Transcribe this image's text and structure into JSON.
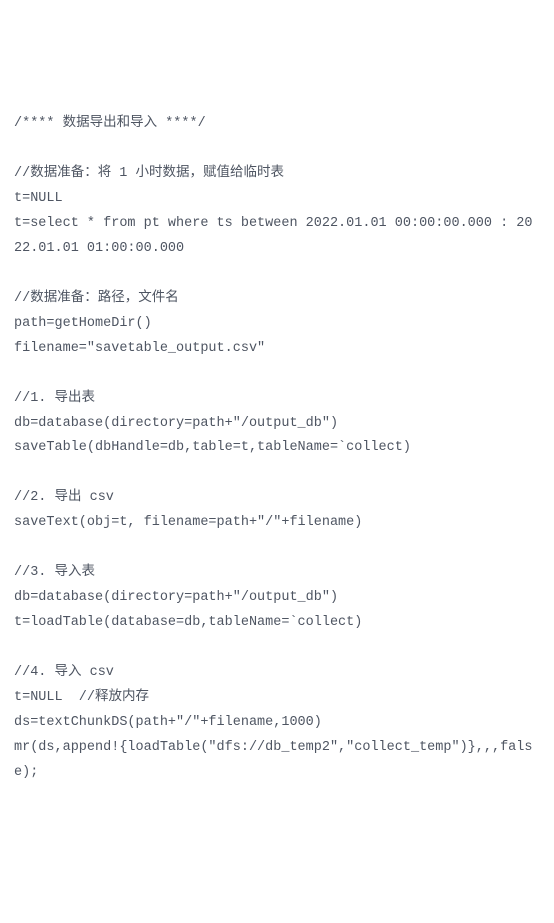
{
  "code": {
    "lines": [
      "/**** 数据导出和导入 ****/",
      "",
      "//数据准备：将 1 小时数据，赋值给临时表",
      "t=NULL",
      "t=select * from pt where ts between 2022.01.01 00:00:00.000 : 2022.01.01 01:00:00.000",
      "",
      "//数据准备：路径，文件名",
      "path=getHomeDir()",
      "filename=\"savetable_output.csv\"",
      "",
      "//1. 导出表",
      "db=database(directory=path+\"/output_db\")",
      "saveTable(dbHandle=db,table=t,tableName=`collect)",
      "",
      "//2. 导出 csv",
      "saveText(obj=t, filename=path+\"/\"+filename)",
      "",
      "//3. 导入表",
      "db=database(directory=path+\"/output_db\")",
      "t=loadTable(database=db,tableName=`collect)",
      "",
      "//4. 导入 csv",
      "t=NULL  //释放内存",
      "ds=textChunkDS(path+\"/\"+filename,1000)",
      "mr(ds,append!{loadTable(\"dfs://db_temp2\",\"collect_temp\")},,,false);"
    ]
  }
}
